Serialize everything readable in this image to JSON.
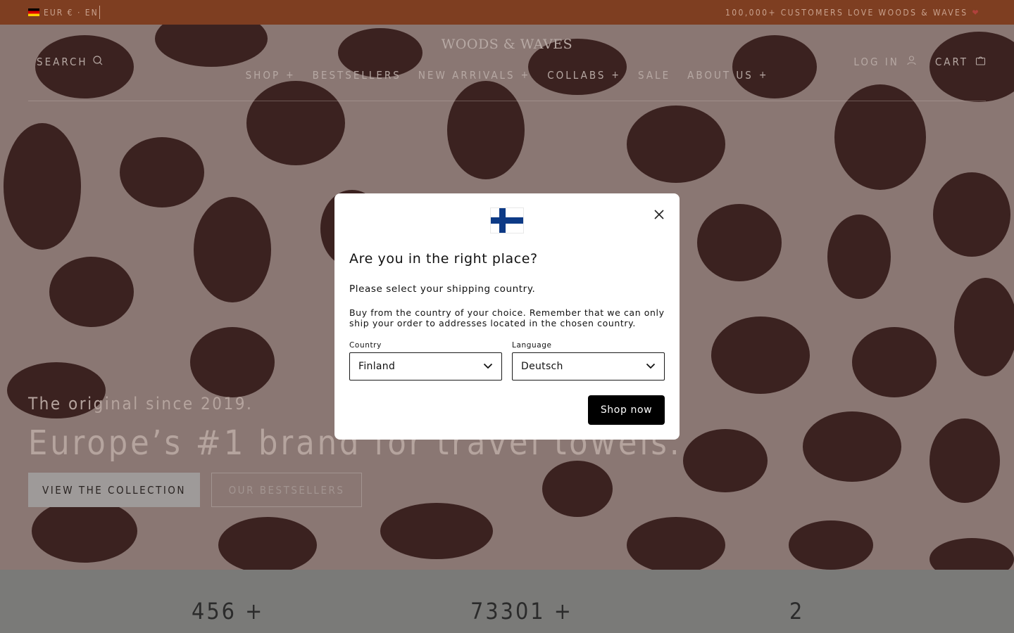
{
  "topbar": {
    "locale": "EUR € · EN",
    "promo": "100,000+ CUSTOMERS LOVE WOODS & WAVES",
    "heart": "❤"
  },
  "header": {
    "logo": "WOODS & WAVES",
    "search_label": "SEARCH",
    "login_label": "LOG IN",
    "cart_label": "CART"
  },
  "nav": [
    {
      "label": "SHOP",
      "expand": "+"
    },
    {
      "label": "BESTSELLERS",
      "expand": ""
    },
    {
      "label": "NEW ARRIVALS",
      "expand": "+"
    },
    {
      "label": "COLLABS",
      "expand": "+"
    },
    {
      "label": "SALE",
      "expand": ""
    },
    {
      "label": "ABOUT US",
      "expand": "+"
    }
  ],
  "hero": {
    "tagline": "The original since 2019.",
    "headline": "Europe’s #1 brand for travel towels.",
    "primary_button": "VIEW THE COLLECTION",
    "secondary_button": "OUR BESTSELLERS"
  },
  "stats": [
    {
      "value": "456 +"
    },
    {
      "value": "73301 +"
    },
    {
      "value": "2"
    }
  ],
  "modal": {
    "title": "Are you in the right place?",
    "subtitle": "Please select your shipping country.",
    "description": "Buy from the country of your choice. Remember that we can only ship your order to addresses located in the chosen country.",
    "country_label": "Country",
    "country_value": "Finland",
    "language_label": "Language",
    "language_value": "Deutsch",
    "submit_label": "Shop now",
    "flag": "finland-flag-icon"
  },
  "colors": {
    "announcement_bg": "#7e3e21",
    "overlay": "#3c2422",
    "modal_bg": "#ffffff",
    "button_dark": "#000000",
    "flag_blue": "#0d3a86"
  }
}
